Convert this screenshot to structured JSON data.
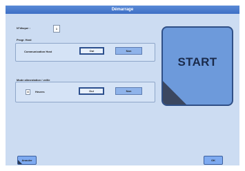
{
  "window": {
    "title": "Démarrage"
  },
  "disk": {
    "label": "N°disque :",
    "value": "1"
  },
  "network_group": {
    "title": "Progr. Host",
    "row_label": "Communication Host",
    "options": [
      "Oui",
      "Non"
    ],
    "selected": "Oui"
  },
  "power_group": {
    "title": "Mode alimentation / veille",
    "value": "4",
    "unit": "Heures",
    "options": [
      "Oui",
      "Non"
    ],
    "selected": "Oui"
  },
  "start_button": {
    "label": "START"
  },
  "footer": {
    "left_label": "Annuler",
    "right_label": "OK"
  },
  "colors": {
    "titlebar": "#4a7bcf",
    "client_bg": "#ccdcf2",
    "start_bg": "#6d9adb",
    "button_active": "#8fb3ea"
  }
}
